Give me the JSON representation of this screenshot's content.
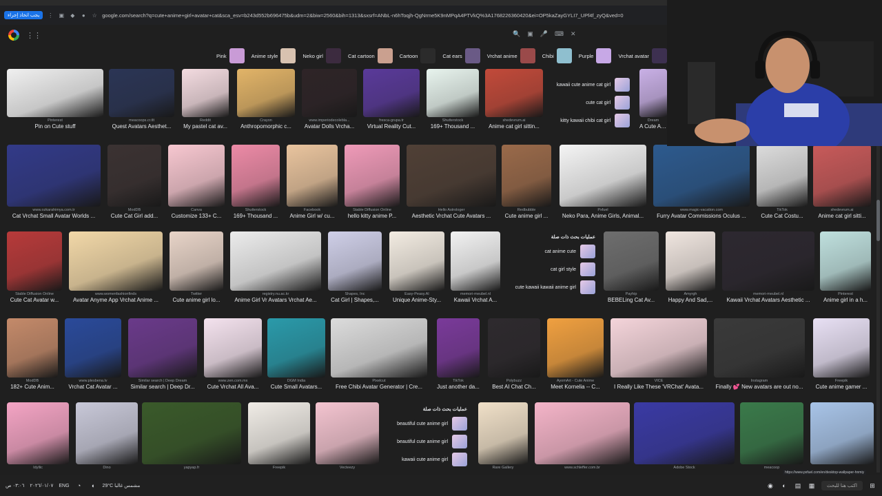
{
  "browser": {
    "signin_label": "يجب اتخاذ إجراء",
    "url": "google.com/search?q=cute+anime+girl+avatar+cat&sca_esv=b243d552b696475b&udm=2&biw=2560&bih=1313&sxsrf=ANbL-n6hToqjh-QgNrme5K9nMPqA4PTVkQ%3A1768226360420&ei=OP5kaZayGYLI7_UPf4f_zyQ&ved=0"
  },
  "chips": [
    {
      "label": "Pink",
      "color": "#c99bd6"
    },
    {
      "label": "Anime style",
      "color": "#d8c2b0"
    },
    {
      "label": "Neko girl",
      "color": "#3c2b3f"
    },
    {
      "label": "Cat cartoon",
      "color": "#caa08f"
    },
    {
      "label": "Cartoon",
      "color": "#2b2b2b"
    },
    {
      "label": "Cat ears",
      "color": "#6a5a86"
    },
    {
      "label": "Vrchat anime",
      "color": "#9a4a4a"
    },
    {
      "label": "Chibi",
      "color": "#8fbfcf"
    },
    {
      "label": "Purple",
      "color": "#c7a8e6"
    },
    {
      "label": "Vrchat avatar",
      "color": "#3d3050"
    }
  ],
  "rows": [
    [
      {
        "src": "Pinterest",
        "title": "Pin on Cute stuff",
        "color": "#f0f0f0"
      },
      {
        "src": "meacoops.cr.tlt",
        "title": "Quest Avatars Aesthet...",
        "color": "#2b3555"
      },
      {
        "src": "Reddit",
        "title": "My pastel cat av...",
        "color": "#f3dbe0"
      },
      {
        "src": "Crayon",
        "title": "Anthropomorphic c...",
        "color": "#e2b468"
      },
      {
        "src": "www.imperiodecolebla...",
        "title": "Avatar Dolls Vrcha...",
        "color": "#2e2427"
      },
      {
        "src": "fresca-grupa.tr",
        "title": "Virtual Reality Cut...",
        "color": "#5a3a9a"
      },
      {
        "src": "Shutterstock",
        "title": "169+ Thousand ...",
        "color": "#e8f4ee"
      },
      {
        "src": "shedevrum.ai",
        "title": "Anime cat girl sittin...",
        "color": "#c24a3a"
      },
      {
        "src": "Dream",
        "title": "A Cute An...",
        "color": "#c9b0e6"
      }
    ],
    [
      {
        "src": "www.ozkarahimya.com.tr",
        "title": "Cat Vrchat Small Avatar Worlds ...",
        "color": "#323a88"
      },
      {
        "src": "ModDB",
        "title": "Cute Cat Girl add...",
        "color": "#3b3232"
      },
      {
        "src": "Canva",
        "title": "Customize 133+ C...",
        "color": "#f7c7d0"
      },
      {
        "src": "Shutterstock",
        "title": "169+ Thousand ...",
        "color": "#ec8aa6"
      },
      {
        "src": "Facebook",
        "title": "Anime Girl w/ cu...",
        "color": "#e9c49e"
      },
      {
        "src": "Stable Diffusion Online",
        "title": "hello kitty anime P...",
        "color": "#ef9ab8"
      },
      {
        "src": "Hello Astrologer",
        "title": "Aesthetic Vrchat Cute Avatars ...",
        "color": "#504036"
      },
      {
        "src": "Redbubble",
        "title": "Cute anime girl ...",
        "color": "#9a6a4a"
      },
      {
        "src": "Pxfuel",
        "title": "Neko Para, Anime Girls, Animal...",
        "color": "#f4f4f4"
      },
      {
        "src": "www.magic-vacation.com",
        "title": "Furry Avatar Commissions Oculus ...",
        "color": "#2d5a8e"
      },
      {
        "src": "TikTok",
        "title": "Cute Cat Costu...",
        "color": "#dcdcdc"
      },
      {
        "src": "shedevrum.ai",
        "title": "Anime cat girl sitti...",
        "color": "#c85a5a"
      }
    ],
    [
      {
        "src": "Stable Diffusion Online",
        "title": "Cute Cat Avatar w...",
        "color": "#b73a3a"
      },
      {
        "src": "www.womenfashionfinds",
        "title": "Avatar Anyme App Vrchat Anime ...",
        "color": "#f2d8a8"
      },
      {
        "src": "Twitter",
        "title": "Cute anime girl lo...",
        "color": "#e8d4c8"
      },
      {
        "src": "registry.nu.ac.kr",
        "title": "Anime Girl Vr Avatars Vrchat Ae...",
        "color": "#ececec"
      },
      {
        "src": "Shapes, Inc",
        "title": "Cat Girl | Shapes,...",
        "color": "#cfcfe8"
      },
      {
        "src": "Easy-Peasy.AI",
        "title": "Unique Anime-Sty...",
        "color": "#f3ece2"
      },
      {
        "src": "memori-meubel.nl",
        "title": "Kawaii Vrchat A...",
        "color": "#f2f2f2"
      },
      {
        "src": "Payhip",
        "title": "BEBELing Cat Av...",
        "color": "#6e6e6e"
      },
      {
        "src": "Amyrgh",
        "title": "Happy And Sad,...",
        "color": "#f0e6e0"
      },
      {
        "src": "memori-meubel.nl",
        "title": "Kawaii Vrchat Avatars Aesthetic ...",
        "color": "#2d2830"
      },
      {
        "src": "Pinterest",
        "title": "Anime girl in a h...",
        "color": "#bfe0de"
      }
    ],
    [
      {
        "src": "ModDB",
        "title": "182+ Cute Anim...",
        "color": "#c48a6a"
      },
      {
        "src": "www.plesbena.lv",
        "title": "Vrchat Cat Avatar ...",
        "color": "#2a4a9a"
      },
      {
        "src": "Similar search | Deep Dream",
        "title": "Similar search | Deep Dr...",
        "color": "#6a3a8a"
      },
      {
        "src": "www.zen.com.mx",
        "title": "Cute Vrchat All Ava...",
        "color": "#f4e2ee"
      },
      {
        "src": "DGM India",
        "title": "Cute Small Avatars...",
        "color": "#2a9aaa"
      },
      {
        "src": "Pixelcut",
        "title": "Free Chibi Avatar Generator | Cre...",
        "color": "#dcdcdc"
      },
      {
        "src": "TikTok",
        "title": "Just another da...",
        "color": "#7a3a9a"
      },
      {
        "src": "Polybuzz",
        "title": "Best AI Chat Ch...",
        "color": "#2e2a2e"
      },
      {
        "src": "AyomArt - Cute Anime",
        "title": "Meet Kornelia -- C...",
        "color": "#f0a040"
      },
      {
        "src": "VICE",
        "title": "I Really Like These 'VRChat' Avata...",
        "color": "#f4d4da"
      },
      {
        "src": "Instagram",
        "title": "Finally 💕 New avatars are out no...",
        "color": "#3a3a3a"
      },
      {
        "src": "Freepik",
        "title": "Cute anime gamer ...",
        "color": "#e8e0f4"
      }
    ],
    [
      {
        "src": "Idyllic",
        "title": "",
        "color": "#f4a4c4"
      },
      {
        "src": "Dino",
        "title": "",
        "color": "#c8c8d8"
      },
      {
        "src": "yapyap.fr",
        "title": "",
        "color": "#3a5a2a"
      },
      {
        "src": "Freepik",
        "title": "",
        "color": "#f0ece6"
      },
      {
        "src": "Vecteezy",
        "title": "",
        "color": "#f4c4d0"
      },
      {
        "src": "Rare Gallery",
        "title": "",
        "color": "#f0e0c8"
      },
      {
        "src": "www.schleffer.com.br",
        "title": "",
        "color": "#f4b4c8"
      },
      {
        "src": "Adobe Stock",
        "title": "",
        "color": "#3a3aa4"
      },
      {
        "src": "meacoop",
        "title": "",
        "color": "#3a7a4a"
      },
      {
        "src": "",
        "title": "",
        "color": "#a8c4e8"
      }
    ]
  ],
  "related1": {
    "items": [
      {
        "label": "kawaii cute anime cat girl"
      },
      {
        "label": "cute cat girl"
      },
      {
        "label": "kitty kawaii chibi cat girl"
      }
    ]
  },
  "related2": {
    "heading": "عمليات بحث ذات صلة",
    "items": [
      {
        "label": "cat anime cute"
      },
      {
        "label": "cat girl style"
      },
      {
        "label": "cute kawaii kawaii anime girl"
      }
    ]
  },
  "related3": {
    "heading": "عمليات بحث ذات صلة",
    "items": [
      {
        "label": "beautiful cute anime girl"
      },
      {
        "label": "beautiful cute anime girl"
      },
      {
        "label": "kawaii cute anime girl"
      }
    ]
  },
  "status_url": "https://www.pxfuel.com/en/desktop-wallpaper-hnmiy",
  "taskbar": {
    "time": "٠٣:٠٦ ص",
    "date": "٢٠٢٦/٠١/٠٧",
    "lang": "ENG",
    "weather": "29°C مشمس غالبا",
    "search_placeholder": "اكتب هنا للبحث"
  }
}
